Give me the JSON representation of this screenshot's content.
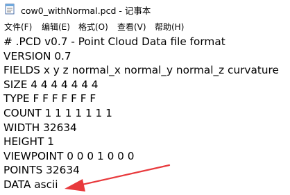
{
  "window": {
    "title": "cow0_withNormal.pcd - 记事本",
    "app_icon": "notepad-icon"
  },
  "menu": [
    "文件(F)",
    "编辑(E)",
    "格式(O)",
    "查看(V)",
    "帮助(H)"
  ],
  "document": {
    "lines": [
      "# .PCD v0.7 - Point Cloud Data file format",
      "VERSION 0.7",
      "FIELDS x y z normal_x normal_y normal_z curvature",
      "SIZE 4 4 4 4 4 4 4",
      "TYPE F F F F F F F",
      "COUNT 1 1 1 1 1 1 1",
      "WIDTH 32634",
      "HEIGHT 1",
      "VIEWPOINT 0 0 0 1 0 0 0",
      "POINTS 32634",
      "DATA ascii"
    ]
  },
  "annotation": {
    "type": "arrow",
    "color": "#e8393c",
    "points_to": "DATA ascii"
  }
}
